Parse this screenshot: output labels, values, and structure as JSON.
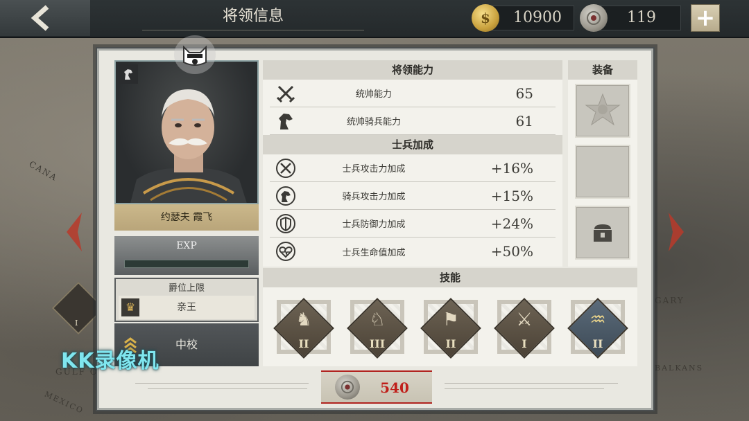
{
  "header": {
    "title": "将领信息",
    "gold_amount": "10900",
    "medal_amount": "119",
    "plus_label": "+"
  },
  "map_labels": [
    "CANA",
    "GARY",
    "BALKANS",
    "GULF OF",
    "MEXICO"
  ],
  "general": {
    "name": "约瑟夫 霞飞",
    "exp_label": "EXP",
    "exp_progress": 0,
    "rank_cap_title": "爵位上限",
    "rank_cap_value": "亲王",
    "military_rank": "中校"
  },
  "abilities": {
    "header": "将领能力",
    "rows": [
      {
        "icon": "crossed-swords-icon",
        "label": "统帅能力",
        "value": "65"
      },
      {
        "icon": "horse-head-icon",
        "label": "统帅骑兵能力",
        "value": "61"
      }
    ]
  },
  "bonuses": {
    "header": "士兵加成",
    "rows": [
      {
        "icon": "attack-bonus-icon",
        "label": "士兵攻击力加成",
        "value": "+16%"
      },
      {
        "icon": "cavalry-bonus-icon",
        "label": "骑兵攻击力加成",
        "value": "+15%"
      },
      {
        "icon": "defense-bonus-icon",
        "label": "士兵防御力加成",
        "value": "+24%"
      },
      {
        "icon": "health-bonus-icon",
        "label": "士兵生命值加成",
        "value": "+50%"
      }
    ]
  },
  "equipment": {
    "header": "装备",
    "slots": [
      "medal-emblem-icon",
      "empty-slot",
      "chest-lock-icon"
    ]
  },
  "skills": {
    "header": "技能",
    "items": [
      {
        "icon": "knight-skill-icon",
        "level": "II"
      },
      {
        "icon": "cavalry-charge-icon",
        "level": "III"
      },
      {
        "icon": "fortify-icon",
        "level": "II"
      },
      {
        "icon": "infantry-icon",
        "level": "I"
      },
      {
        "icon": "trench-icon",
        "level": "II"
      }
    ]
  },
  "cost": {
    "value": "540"
  },
  "watermark": "KK录像机",
  "left_badge_level": "I"
}
